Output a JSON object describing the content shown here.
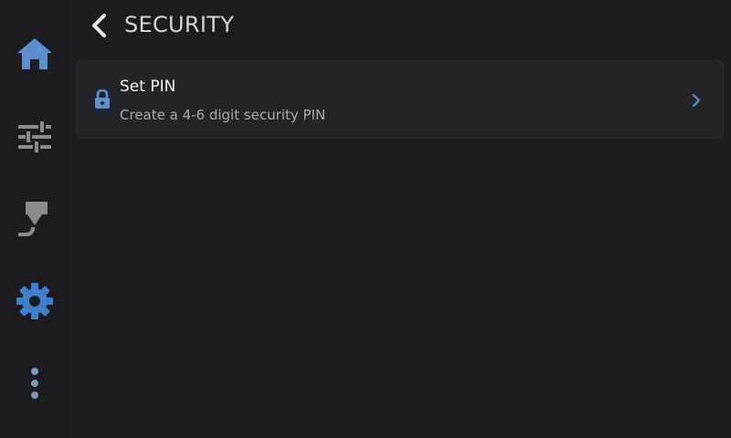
{
  "header": {
    "title": "SECURITY"
  },
  "sidebar": {
    "items": [
      {
        "icon": "home-icon",
        "active": false
      },
      {
        "icon": "sliders-icon",
        "active": false
      },
      {
        "icon": "extruder-icon",
        "active": false
      },
      {
        "icon": "gear-icon",
        "active": true
      },
      {
        "icon": "more-vertical-icon",
        "active": false
      }
    ]
  },
  "main": {
    "settings": [
      {
        "icon": "lock-icon",
        "title": "Set PIN",
        "subtitle": "Create a 4-6 digit security PIN"
      }
    ]
  },
  "colors": {
    "background": "#1c1b1f",
    "card": "#242329",
    "accent": "#5b8fcf",
    "active": "#3f7fcf",
    "icon_inactive": "#8a8a90"
  }
}
